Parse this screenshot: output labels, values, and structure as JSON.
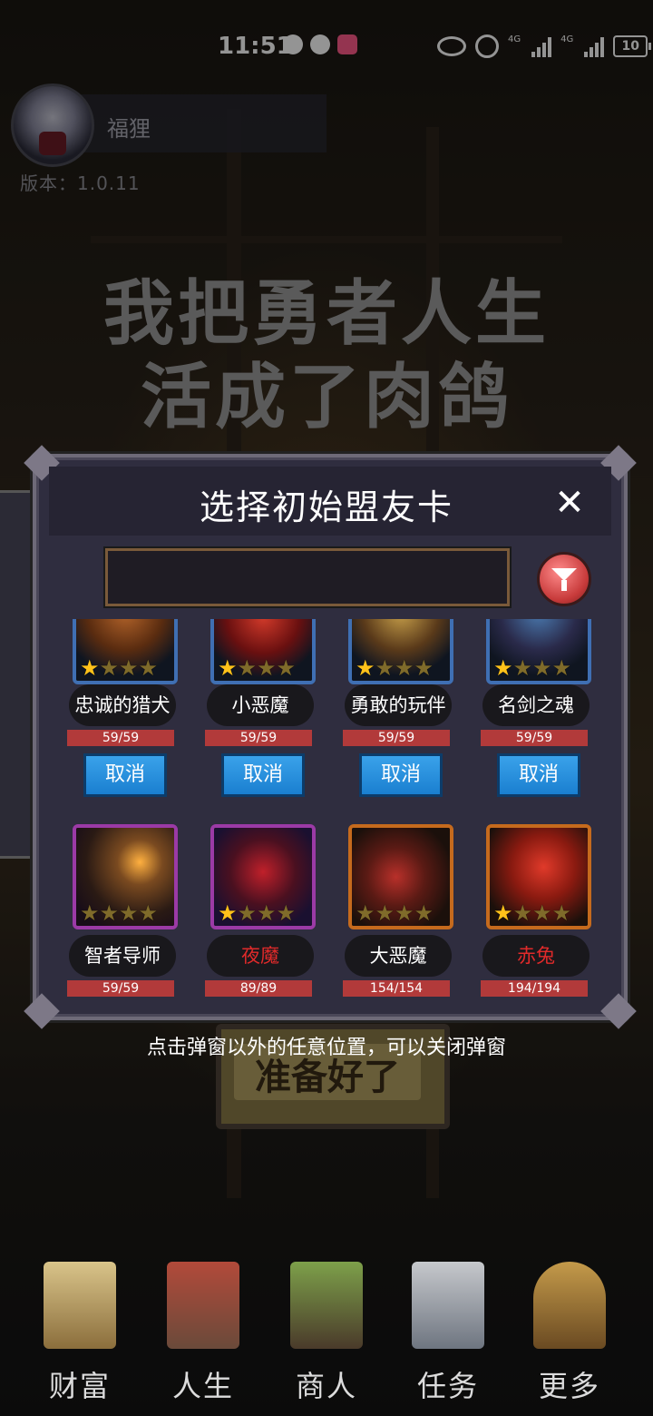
{
  "status_bar": {
    "time": "11:51",
    "network": "4G",
    "battery": "10"
  },
  "player": {
    "name": "福狸",
    "version": "版本：1.0.11"
  },
  "game_title": {
    "line1": "我把勇者人生",
    "line2": "活成了肉鸽"
  },
  "dialog": {
    "title": "选择初始盟友卡",
    "close_symbol": "✕",
    "search": {
      "value": "",
      "placeholder": ""
    },
    "filter_icon": "filter-funnel",
    "cards": [
      {
        "name": "忠诚的猎犬",
        "hp": "59/59",
        "stars_lit": 1,
        "frame": "blue",
        "name_color": "white",
        "action": "取消"
      },
      {
        "name": "小恶魔",
        "hp": "59/59",
        "stars_lit": 1,
        "frame": "blue",
        "name_color": "white",
        "action": "取消"
      },
      {
        "name": "勇敢的玩伴",
        "hp": "59/59",
        "stars_lit": 1,
        "frame": "blue",
        "name_color": "white",
        "action": "取消"
      },
      {
        "name": "名剑之魂",
        "hp": "59/59",
        "stars_lit": 1,
        "frame": "blue",
        "name_color": "white",
        "action": "取消"
      },
      {
        "name": "智者导师",
        "hp": "59/59",
        "stars_lit": 0,
        "frame": "purple",
        "name_color": "white"
      },
      {
        "name": "夜魔",
        "hp": "89/89",
        "stars_lit": 1,
        "frame": "purple",
        "name_color": "red"
      },
      {
        "name": "大恶魔",
        "hp": "154/154",
        "stars_lit": 0,
        "frame": "orange",
        "name_color": "white"
      },
      {
        "name": "赤兔",
        "hp": "194/194",
        "stars_lit": 1,
        "frame": "orange",
        "name_color": "red"
      }
    ]
  },
  "hint": "点击弹窗以外的任意位置，可以关闭弹窗",
  "ready_button": "准备好了",
  "bottom_nav": [
    {
      "label": "财富",
      "icon": "castle-icon"
    },
    {
      "label": "人生",
      "icon": "tower-icon"
    },
    {
      "label": "商人",
      "icon": "shop-icon"
    },
    {
      "label": "任务",
      "icon": "quest-icon"
    },
    {
      "label": "更多",
      "icon": "more-icon"
    }
  ],
  "colors": {
    "dialog_bg": "#2f2d3f",
    "cancel_button": "#2a90e0",
    "hp_bar": "#b23a3a",
    "star_lit": "#ffc21a",
    "name_red": "#e02a2a"
  }
}
